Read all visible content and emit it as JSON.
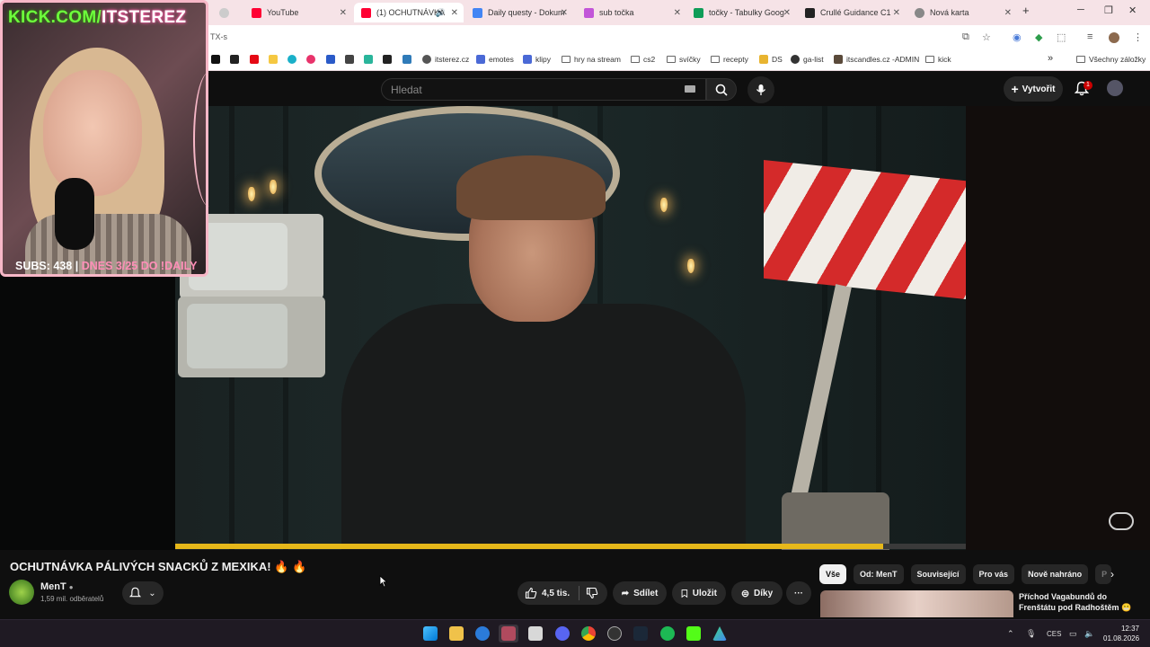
{
  "browser": {
    "tabs": [
      {
        "label": "",
        "color": "#bbbbbb"
      },
      {
        "label": "YouTube",
        "color": "#ff0033"
      },
      {
        "label": "(1) OCHUTNÁVKA",
        "color": "#ff0033"
      },
      {
        "label": "Daily questy - Dokum",
        "color": "#4285f4"
      },
      {
        "label": "sub točka",
        "color": "#c255d8"
      },
      {
        "label": "točky - Tabulky Goog",
        "color": "#0f9d58"
      },
      {
        "label": "Crullé Guidance C1",
        "color": "#222222"
      },
      {
        "label": "Nová karta",
        "color": "#888888"
      }
    ],
    "new_tab": "+",
    "url": "TX-s",
    "bookmarks": [
      {
        "label": "",
        "icon": "x-icon"
      },
      {
        "label": "",
        "icon": "amazon-icon"
      },
      {
        "label": "",
        "icon": "netflix-icon"
      },
      {
        "label": "",
        "icon": "app-icon"
      },
      {
        "label": "",
        "icon": "app-icon"
      },
      {
        "label": "",
        "icon": "app-icon"
      },
      {
        "label": "",
        "icon": "paypal-icon"
      },
      {
        "label": "",
        "icon": "app-icon"
      },
      {
        "label": "",
        "icon": "app-icon"
      },
      {
        "label": "",
        "icon": "download-icon"
      },
      {
        "label": "",
        "icon": "app-icon"
      },
      {
        "label": "itsterez.cz",
        "icon": "globe-icon"
      },
      {
        "label": "emotes",
        "icon": "app-icon"
      },
      {
        "label": "klipy",
        "icon": "app-icon"
      },
      {
        "label": "hry na stream",
        "icon": "folder-icon"
      },
      {
        "label": "cs2",
        "icon": "folder-icon"
      },
      {
        "label": "svíčky",
        "icon": "folder-icon"
      },
      {
        "label": "recepty",
        "icon": "folder-icon"
      },
      {
        "label": "DS",
        "icon": "app-icon"
      },
      {
        "label": "ga-list",
        "icon": "globe-icon"
      },
      {
        "label": "itscandles.cz -ADMIN",
        "icon": "app-icon"
      },
      {
        "label": "kick",
        "icon": "folder-icon"
      }
    ],
    "bookmarks_more": "»",
    "all_bookmarks": "Všechny záložky"
  },
  "youtube": {
    "search_placeholder": "Hledat",
    "create_label": "Vytvořit",
    "notification_count": "1",
    "video": {
      "title": "OCHUTNÁVKA PÁLIVÝCH SNACKŮ Z MEXIKA! 🔥 🔥",
      "progress": 0.895
    },
    "channel": {
      "name": "MenT",
      "subscribers": "1,59 mil. odběratelů"
    },
    "actions": {
      "likes": "4,5 tis.",
      "share": "Sdílet",
      "save": "Uložit",
      "thanks": "Díky"
    },
    "chips": [
      "Vše",
      "Od: MenT",
      "Související",
      "Pro vás",
      "Nově nahráno",
      "P"
    ],
    "recommended": {
      "title": "Příchod Vagabundů do Frenštátu pod Radhoštěm 😬"
    }
  },
  "overlay": {
    "title_prefix": "KICK.COM/",
    "title_name": "ITSTEREZ",
    "subs_label": "SUBS: 438 |",
    "daily_label": "DNES 3/25 DO !DAILY"
  },
  "taskbar": {
    "lang": "CES",
    "time": "12:37",
    "date": "01.08.2026"
  },
  "colors": {
    "accent": "#ff0033",
    "progress": "#e6b81a",
    "overlay_border": "#f7b7c7",
    "overlay_green": "#6dff3c"
  }
}
